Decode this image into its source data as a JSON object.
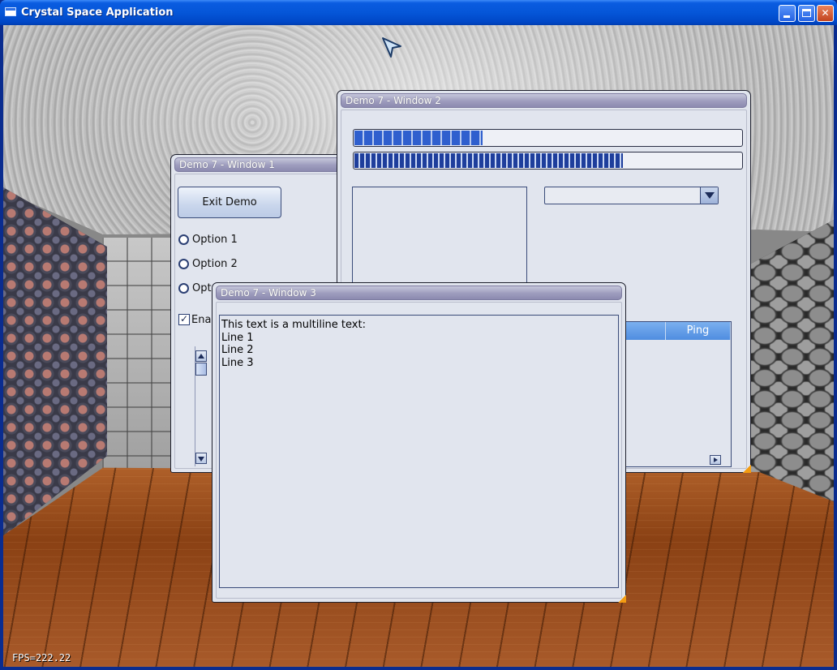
{
  "window": {
    "title": "Crystal Space Application",
    "controls": {
      "minimize": "",
      "maximize": "",
      "close": "✕"
    }
  },
  "hud": {
    "fps": "FPS=222.22"
  },
  "window1": {
    "title": "Demo 7 - Window 1",
    "exit_button": "Exit Demo",
    "options": [
      "Option 1",
      "Option 2",
      "Opt"
    ],
    "checkbox_label": "Ena",
    "checkbox_checked": true
  },
  "window2": {
    "title": "Demo 7 - Window 2",
    "progress1": 0.33,
    "progress2": 0.69,
    "combo_value": "",
    "columns": [
      "",
      "Ping"
    ]
  },
  "window3": {
    "title": "Demo 7 - Window 3",
    "text": "This text is a multiline text:\nLine 1\nLine 2\nLine 3"
  },
  "colors": {
    "titlebar": "#0556d8",
    "panel": "#e1e5ee",
    "progress_fill": "#2f5fce",
    "header_blue": "#4f8de0",
    "resize_grip": "#f39c12"
  }
}
